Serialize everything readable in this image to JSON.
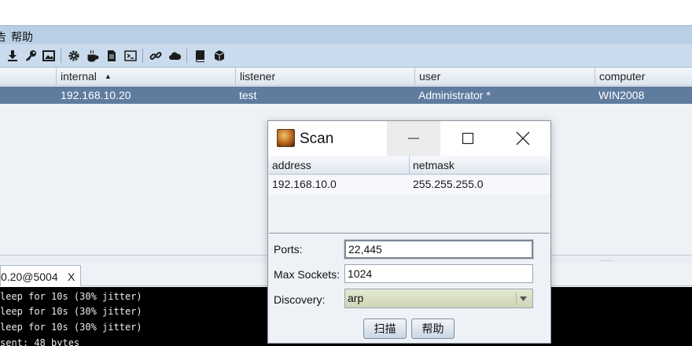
{
  "menubar": {
    "items": [
      "告",
      "帮助"
    ]
  },
  "toolbar": {
    "icons": [
      "download-icon",
      "key-icon",
      "image-icon",
      "gear-icon",
      "coffee-icon",
      "document-icon",
      "terminal-icon",
      "link-icon",
      "cloud-icon",
      "book-icon",
      "cube-icon"
    ]
  },
  "sessions": {
    "columns": [
      "internal",
      "listener",
      "user",
      "computer"
    ],
    "sort_indicator": "▲",
    "rows": [
      {
        "internal": "192.168.10.20",
        "listener": "test",
        "user": "Administrator *",
        "computer": "WIN2008"
      }
    ]
  },
  "tab": {
    "label": "0.20@5004",
    "close": "X"
  },
  "console": {
    "lines": [
      "leep for 10s (30% jitter)",
      "leep for 10s (30% jitter)",
      "leep for 10s (30% jitter)",
      "sent: 48 bytes"
    ]
  },
  "dialog": {
    "title": "Scan",
    "table": {
      "columns": [
        "address",
        "netmask"
      ],
      "rows": [
        {
          "address": "192.168.10.0",
          "netmask": "255.255.255.0"
        }
      ]
    },
    "ports": {
      "label": "Ports:",
      "value": "22,445"
    },
    "max_sockets": {
      "label": "Max Sockets:",
      "value": "1024"
    },
    "discovery": {
      "label": "Discovery:",
      "value": "arp"
    },
    "buttons": {
      "scan": "扫描",
      "help": "帮助"
    }
  }
}
